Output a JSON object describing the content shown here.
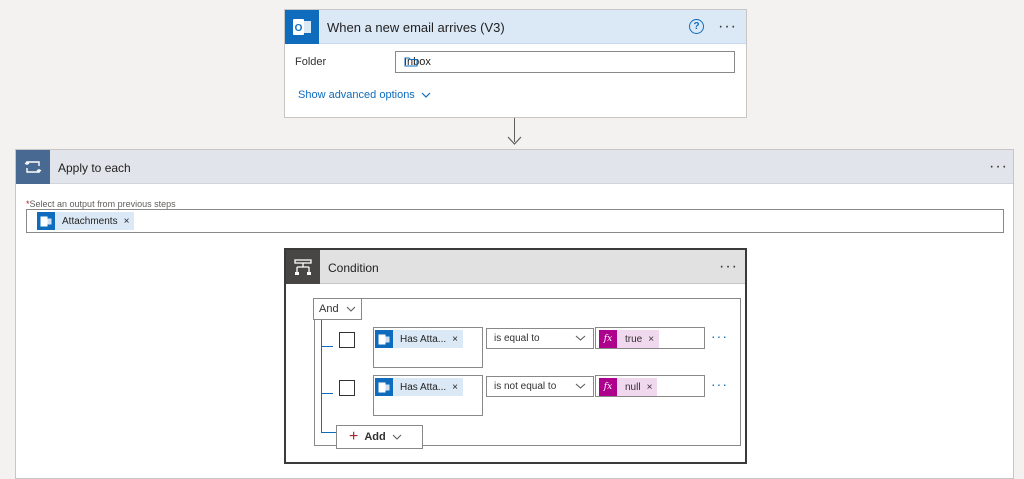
{
  "trigger": {
    "title": "When a new email arrives (V3)",
    "help_glyph": "?",
    "more_glyph": "···",
    "folder_label": "Folder",
    "folder_value": "Inbox",
    "show_advanced": "Show advanced options",
    "icon": "outlook-icon",
    "accent": "#0f6cbd"
  },
  "loop": {
    "title": "Apply to each",
    "more_glyph": "···",
    "select_label": "Select an output from previous steps",
    "required_mark": "*",
    "token": {
      "label": "Attachments",
      "remove": "×"
    },
    "icon": "loop-icon",
    "accent": "#486991"
  },
  "condition": {
    "title": "Condition",
    "more_glyph": "···",
    "group_operator": "And",
    "icon": "condition-icon",
    "rows": [
      {
        "operand": "Has Atta...",
        "operator": "is equal to",
        "value": "true",
        "remove": "×",
        "more_glyph": "···"
      },
      {
        "operand": "Has Atta...",
        "operator": "is not equal to",
        "value": "null",
        "remove": "×",
        "more_glyph": "···"
      }
    ],
    "add_label": "Add",
    "expression_glyph": "fx",
    "expression_color": "#ad008c"
  }
}
